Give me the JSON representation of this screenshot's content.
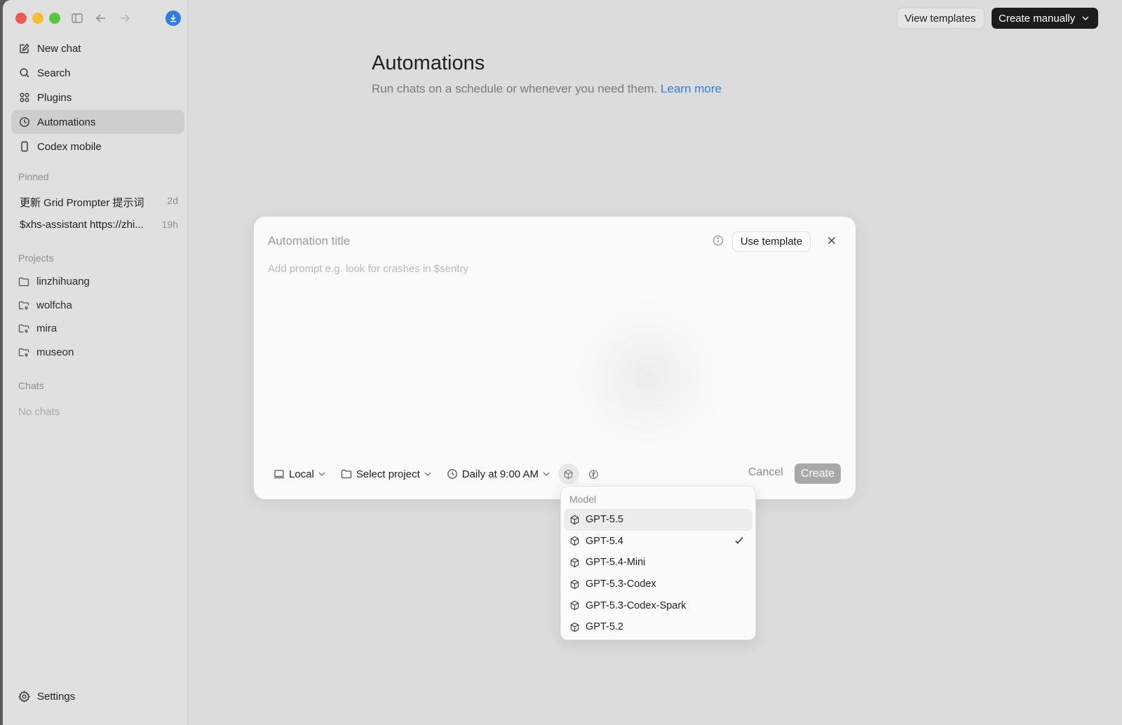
{
  "sidebar": {
    "nav": [
      {
        "label": "New chat",
        "icon": "compose-icon"
      },
      {
        "label": "Search",
        "icon": "search-icon"
      },
      {
        "label": "Plugins",
        "icon": "grid-icon"
      },
      {
        "label": "Automations",
        "icon": "clock-icon",
        "active": true
      },
      {
        "label": "Codex mobile",
        "icon": "phone-icon"
      }
    ],
    "pinned_label": "Pinned",
    "pinned": [
      {
        "title": "更新 Grid Prompter 提示词",
        "age": "2d"
      },
      {
        "title": "$xhs-assistant https://zhi...",
        "age": "19h"
      }
    ],
    "projects_label": "Projects",
    "projects": [
      "linzhihuang",
      "wolfcha",
      "mira",
      "museon"
    ],
    "chats_label": "Chats",
    "no_chats": "No chats",
    "settings": "Settings"
  },
  "topbar": {
    "view_templates": "View templates",
    "create_manually": "Create manually"
  },
  "page": {
    "title": "Automations",
    "subtitle": "Run chats on a schedule or whenever you need them.",
    "learn_more": "Learn more"
  },
  "modal": {
    "title_placeholder": "Automation title",
    "prompt_placeholder": "Add prompt e.g. look for crashes in $sentry",
    "use_template": "Use template",
    "env": "Local",
    "project": "Select project",
    "schedule": "Daily at 9:00 AM",
    "cancel": "Cancel",
    "create": "Create"
  },
  "model_menu": {
    "header": "Model",
    "items": [
      "GPT-5.5",
      "GPT-5.4",
      "GPT-5.4-Mini",
      "GPT-5.3-Codex",
      "GPT-5.3-Codex-Spark",
      "GPT-5.2"
    ],
    "selected": "GPT-5.4",
    "hovered": "GPT-5.5"
  },
  "colors": {
    "accent": "#2f7de1",
    "primary_button": "#1c1c1c",
    "disabled_button": "#a8a8a8"
  }
}
